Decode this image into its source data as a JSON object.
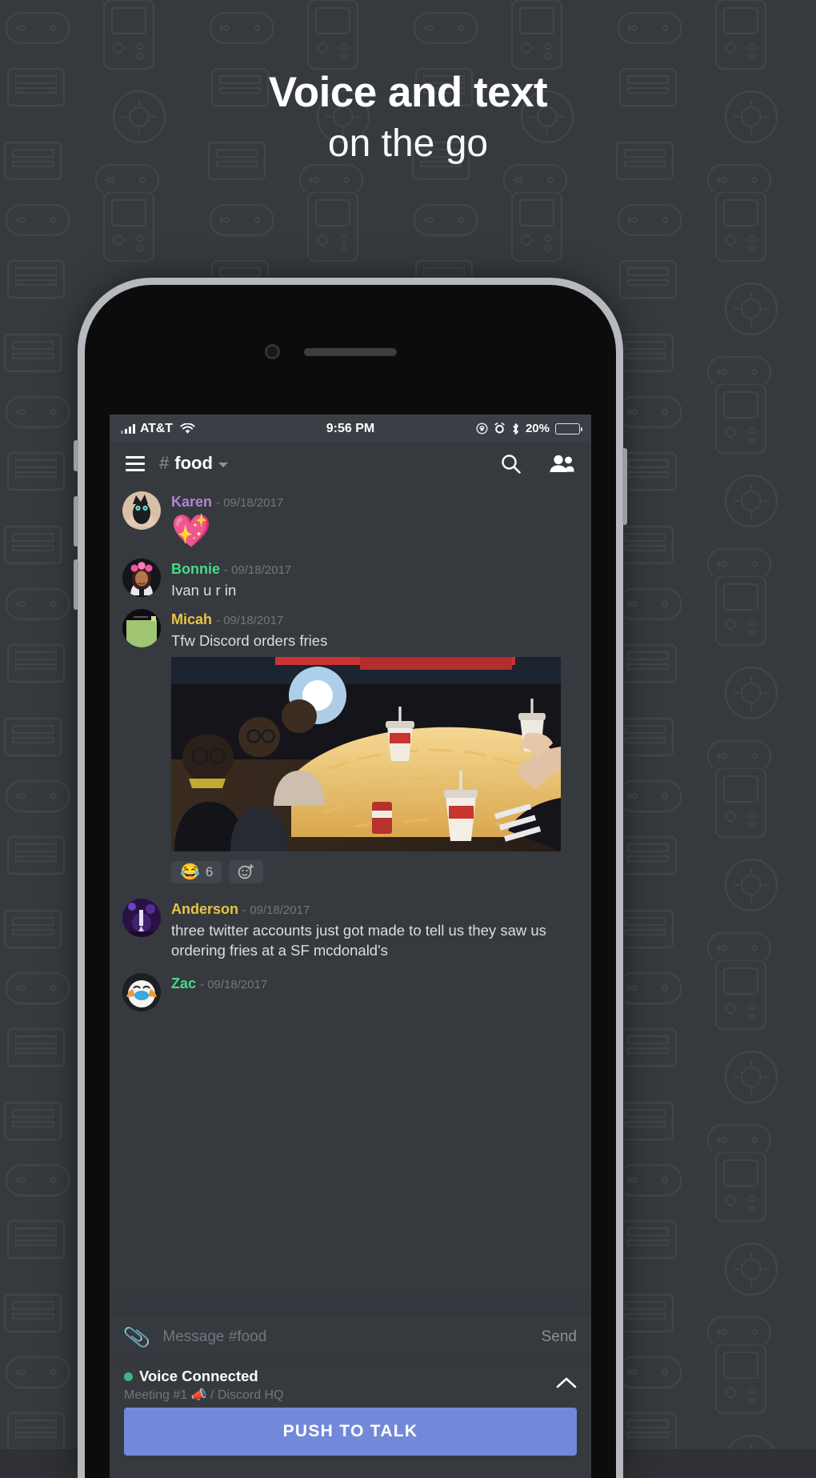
{
  "hero": {
    "line1": "Voice and text",
    "line2": "on the go"
  },
  "colors": {
    "page_bg": "#36393e",
    "accent_blurple": "#7289da",
    "online_green": "#43b581",
    "battery_yellow": "#ffd42a",
    "name_purple": "#b085cf",
    "name_green": "#44dd88",
    "name_gold": "#e8c545"
  },
  "status_bar": {
    "carrier": "AT&T",
    "signal_icon": "signal-bars-icon",
    "wifi_icon": "wifi-icon",
    "time": "9:56 PM",
    "rotation_lock_icon": "rotation-lock-icon",
    "alarm_icon": "alarm-clock-icon",
    "bluetooth_icon": "bluetooth-icon",
    "battery_percent": "20%",
    "battery_level": 20
  },
  "channel_header": {
    "menu_icon": "hamburger-menu-icon",
    "hash": "#",
    "channel_name": "food",
    "dropdown_icon": "chevron-down-icon",
    "search_icon": "search-icon",
    "members_icon": "members-icon"
  },
  "messages": [
    {
      "author": "Karen",
      "author_color": "purple",
      "timestamp": "09/18/2017",
      "avatar": "black-cat-avatar",
      "emoji": "💖",
      "text": ""
    },
    {
      "author": "Bonnie",
      "author_color": "green",
      "timestamp": "09/18/2017",
      "avatar": "girl-flower-crown-avatar",
      "text": "Ivan u r in"
    },
    {
      "author": "Micah",
      "author_color": "gold",
      "timestamp": "09/18/2017",
      "avatar": "green-screen-avatar",
      "text": "Tfw Discord orders fries",
      "attachment": "photo-of-people-eating-huge-pile-of-fries",
      "reaction_emoji": "😂",
      "reaction_count": "6",
      "add_reaction_icon": "add-reaction-icon"
    },
    {
      "author": "Anderson",
      "author_color": "gold",
      "timestamp": "09/18/2017",
      "avatar": "purple-concert-avatar",
      "text": "three twitter accounts just got made to tell us they saw us ordering fries at a SF mcdonald's"
    },
    {
      "author": "Zac",
      "author_color": "green",
      "timestamp": "09/18/2017",
      "avatar": "hugging-face-avatar",
      "text": ""
    }
  ],
  "input_bar": {
    "attach_icon": "paperclip-icon",
    "placeholder": "Message #food",
    "send_label": "Send"
  },
  "voice_panel": {
    "status_icon": "online-status-dot",
    "status_label": "Voice Connected",
    "channel_line": "Meeting #1 📣 / Discord HQ",
    "expand_icon": "chevron-up-icon"
  },
  "push_to_talk": {
    "label": "PUSH TO TALK"
  }
}
